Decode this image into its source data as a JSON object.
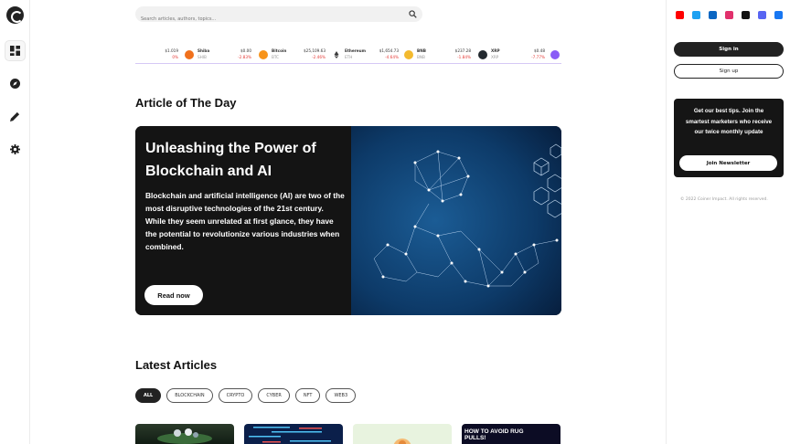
{
  "search": {
    "placeholder": "Search articles, authors, topics..."
  },
  "ticker": [
    {
      "symbol": "",
      "name": "",
      "price": "$1.019",
      "change": "0%",
      "icon": "coin-partial-icon",
      "color": "#ffffff"
    },
    {
      "symbol": "Shiba",
      "name": "SHIB",
      "price": "$0.00",
      "change": "-2.83%",
      "icon": "shiba-coin-icon",
      "color": "#f0701c"
    },
    {
      "symbol": "Bitcoin",
      "name": "BTC",
      "price": "$25,109.63",
      "change": "-2.46%",
      "icon": "bitcoin-coin-icon",
      "color": "#f7931a"
    },
    {
      "symbol": "Ethereum",
      "name": "ETH",
      "price": "$1,654.73",
      "change": "-4.64%",
      "icon": "ethereum-coin-icon",
      "color": "#3c3c3d"
    },
    {
      "symbol": "BNB",
      "name": "BNB",
      "price": "$237.28",
      "change": "-1.84%",
      "icon": "bnb-coin-icon",
      "color": "#f3ba2f"
    },
    {
      "symbol": "XRP",
      "name": "XRP",
      "price": "$0.48",
      "change": "-7.77%",
      "icon": "xrp-coin-icon",
      "color": "#23292f"
    }
  ],
  "article_of_day": {
    "section_title": "Article of The Day",
    "title": "Unleashing the Power of Blockchain and AI",
    "summary": "Blockchain and artificial intelligence (AI) are two of the most disruptive technologies of the 21st century. While they seem unrelated at first glance, they have the potential to revolutionize various industries when combined.",
    "cta": "Read now"
  },
  "latest": {
    "section_title": "Latest Articles",
    "filters": [
      "ALL",
      "BLOCKCHAIN",
      "CRYPTO",
      "CYBER",
      "NFT",
      "WEB3"
    ],
    "thumb_caption": "HOW TO AVOID RUG PULLS!"
  },
  "sidebar": {
    "social_icons": [
      "youtube-icon",
      "twitter-icon",
      "linkedin-icon",
      "instagram-icon",
      "tiktok-icon",
      "discord-icon",
      "facebook-icon"
    ],
    "sign_in": "Sign in",
    "sign_up": "Sign up",
    "newsletter_text": "Get our best tips. Join the smartest marketers who receive our twice monthly update",
    "newsletter_button": "Join Newsletter",
    "copyright": "© 2022 Coiner Impact. All rights reserved."
  },
  "colors": {
    "accent": "#222222",
    "negative": "#e53935",
    "hero_bg": "#141414"
  }
}
